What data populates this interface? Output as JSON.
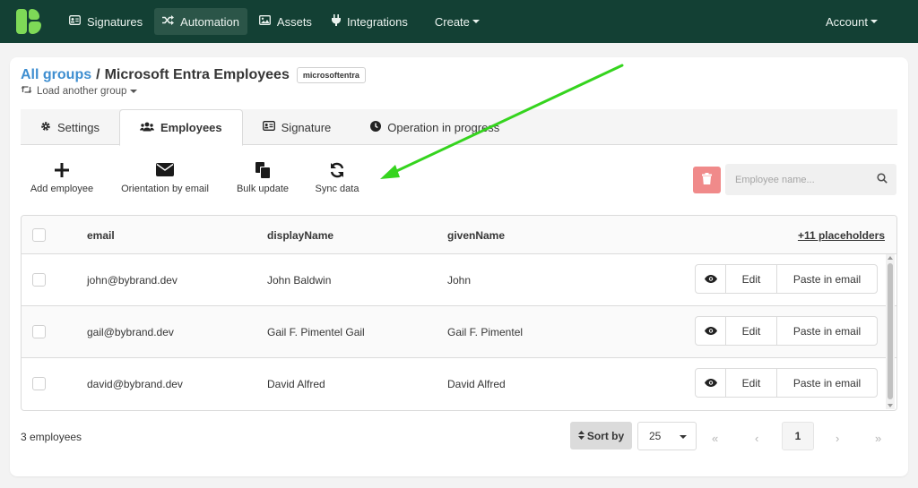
{
  "nav": {
    "items": [
      {
        "label": "Signatures",
        "icon": "id-card-icon"
      },
      {
        "label": "Automation",
        "icon": "shuffle-icon"
      },
      {
        "label": "Assets",
        "icon": "image-icon"
      },
      {
        "label": "Integrations",
        "icon": "plug-icon"
      }
    ],
    "create_label": "Create",
    "account_label": "Account"
  },
  "header": {
    "breadcrumb_link": "All groups",
    "separator": "/",
    "group_name": "Microsoft Entra Employees",
    "tag": "microsoftentra",
    "load_another": "Load another group"
  },
  "tabs": [
    {
      "label": "Settings",
      "icon": "gear-icon"
    },
    {
      "label": "Employees",
      "icon": "users-icon",
      "active": true
    },
    {
      "label": "Signature",
      "icon": "id-card-icon"
    },
    {
      "label": "Operation in progress",
      "icon": "clock-icon"
    }
  ],
  "toolbar": {
    "add_employee": "Add employee",
    "orientation_by_email": "Orientation by email",
    "bulk_update": "Bulk update",
    "sync_data": "Sync data"
  },
  "search": {
    "placeholder": "Employee name..."
  },
  "table": {
    "columns": [
      "email",
      "displayName",
      "givenName"
    ],
    "placeholders_link": "+11 placeholders",
    "rows": [
      {
        "email": "john@bybrand.dev",
        "displayName": "John Baldwin",
        "givenName": "John"
      },
      {
        "email": "gail@bybrand.dev",
        "displayName": "Gail F. Pimentel Gail",
        "givenName": "Gail F. Pimentel"
      },
      {
        "email": "david@bybrand.dev",
        "displayName": "David Alfred",
        "givenName": "David Alfred"
      }
    ],
    "row_actions": {
      "edit": "Edit",
      "paste": "Paste in email"
    }
  },
  "footer": {
    "count": "3 employees",
    "sort_by": "Sort by",
    "per_page": "25",
    "current_page": "1"
  },
  "colors": {
    "navbar": "#134034",
    "logo": "#7ed957",
    "link": "#3e8ed0",
    "annotation_arrow": "#35d41e",
    "danger": "#f08a8a"
  }
}
